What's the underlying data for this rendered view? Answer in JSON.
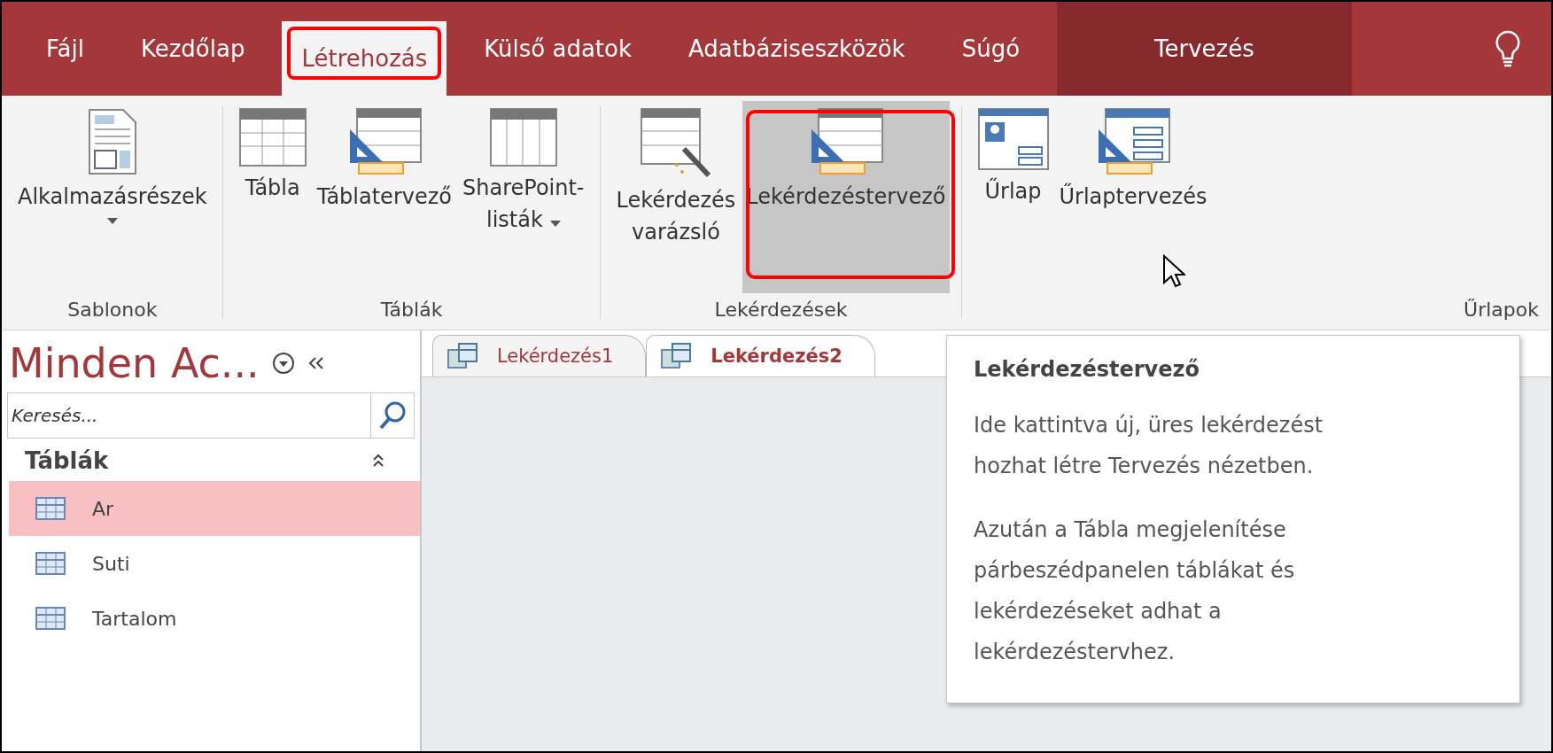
{
  "menu_tabs": [
    {
      "label": "Fájl",
      "selected": false,
      "highlighted": false,
      "contextual": false
    },
    {
      "label": "Kezdőlap",
      "selected": false,
      "highlighted": false,
      "contextual": false
    },
    {
      "label": "Létrehozás",
      "selected": true,
      "highlighted": true,
      "contextual": false
    },
    {
      "label": "Külső adatok",
      "selected": false,
      "highlighted": false,
      "contextual": false
    },
    {
      "label": "Adatbáziseszközök",
      "selected": false,
      "highlighted": false,
      "contextual": false
    },
    {
      "label": "Súgó",
      "selected": false,
      "highlighted": false,
      "contextual": false
    },
    {
      "label": "Tervezés",
      "selected": false,
      "highlighted": false,
      "contextual": true
    }
  ],
  "ribbon_groups": [
    {
      "label": "Sablonok",
      "buttons": [
        {
          "kind": "template",
          "lines": [
            "Alkalmazásrészek"
          ],
          "dropdown": true,
          "hovered": false,
          "highlighted": false
        }
      ]
    },
    {
      "label": "Táblák",
      "buttons": [
        {
          "kind": "table",
          "lines": [
            "Tábla"
          ],
          "dropdown": false,
          "hovered": false,
          "highlighted": false
        },
        {
          "kind": "table-design",
          "lines": [
            "Táblatervező"
          ],
          "dropdown": false,
          "hovered": false,
          "highlighted": false
        },
        {
          "kind": "list",
          "lines": [
            "SharePoint-",
            "listák"
          ],
          "dropdown": true,
          "hovered": false,
          "highlighted": false
        }
      ]
    },
    {
      "label": "Lekérdezések",
      "buttons": [
        {
          "kind": "query-wizard",
          "lines": [
            "Lekérdezés",
            "varázsló"
          ],
          "dropdown": false,
          "hovered": false,
          "highlighted": false
        },
        {
          "kind": "query-design",
          "lines": [
            "Lekérdezéstervező"
          ],
          "dropdown": false,
          "hovered": true,
          "highlighted": true
        }
      ]
    },
    {
      "label": "Űrlapok",
      "buttons": [
        {
          "kind": "form",
          "lines": [
            "Űrlap"
          ],
          "dropdown": false,
          "hovered": false,
          "highlighted": false
        },
        {
          "kind": "form-design",
          "lines": [
            "Űrlaptervezés"
          ],
          "dropdown": false,
          "hovered": false,
          "highlighted": false
        }
      ]
    }
  ],
  "navigation_pane": {
    "title": "Minden Ac...",
    "search": {
      "placeholder": "Keresés..."
    },
    "section": {
      "label": "Táblák",
      "expanded": true
    },
    "items": [
      {
        "label": "Ar",
        "selected": true
      },
      {
        "label": "Suti",
        "selected": false
      },
      {
        "label": "Tartalom",
        "selected": false
      }
    ]
  },
  "document_tabs": [
    {
      "label": "Lekérdezés1",
      "selected": false
    },
    {
      "label": "Lekérdezés2",
      "selected": true
    }
  ],
  "tooltip": {
    "title": "Lekérdezéstervező",
    "paragraphs": [
      "Ide kattintva új, üres lekérdezést hozhat létre Tervezés nézetben.",
      "Azután a Tábla megjelenítése párbeszédpanelen táblákat és lekérdezéseket adhat a lekérdezéstervhez."
    ]
  }
}
